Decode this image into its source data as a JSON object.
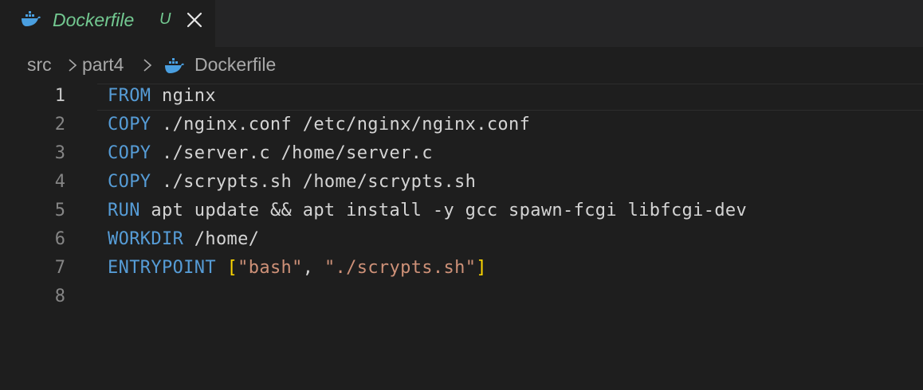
{
  "tab": {
    "icon": "docker-whale-icon",
    "label": "Dockerfile",
    "status": "U",
    "close_icon": "close-icon"
  },
  "breadcrumb": {
    "items": [
      "src",
      "part4",
      "Dockerfile"
    ],
    "separator_icon": "chevron-right-icon",
    "file_icon": "docker-whale-icon"
  },
  "editor": {
    "active_line": 1,
    "lines": [
      {
        "number": "1",
        "keyword": "FROM",
        "rest": " nginx"
      },
      {
        "number": "2",
        "keyword": "COPY",
        "rest": " ./nginx.conf /etc/nginx/nginx.conf"
      },
      {
        "number": "3",
        "keyword": "COPY",
        "rest": " ./server.c /home/server.c"
      },
      {
        "number": "4",
        "keyword": "COPY",
        "rest": " ./scrypts.sh /home/scrypts.sh"
      },
      {
        "number": "5",
        "keyword": "RUN",
        "rest": " apt update && apt install -y gcc spawn-fcgi libfcgi-dev"
      },
      {
        "number": "6",
        "keyword": "WORKDIR",
        "rest": " /home/"
      },
      {
        "number": "7",
        "keyword": "ENTRYPOINT",
        "rest": " ",
        "open_bracket": "[",
        "arg1": "\"bash\"",
        "comma": ", ",
        "arg2": "\"./scrypts.sh\"",
        "close_bracket": "]"
      },
      {
        "number": "8",
        "keyword": "",
        "rest": ""
      }
    ]
  },
  "colors": {
    "background": "#1e1e1e",
    "tabbar": "#252526",
    "keyword": "#569cd6",
    "string": "#ce9178",
    "bracket": "#ffd700",
    "untracked": "#73c991",
    "docker": "#4a9fe0"
  }
}
